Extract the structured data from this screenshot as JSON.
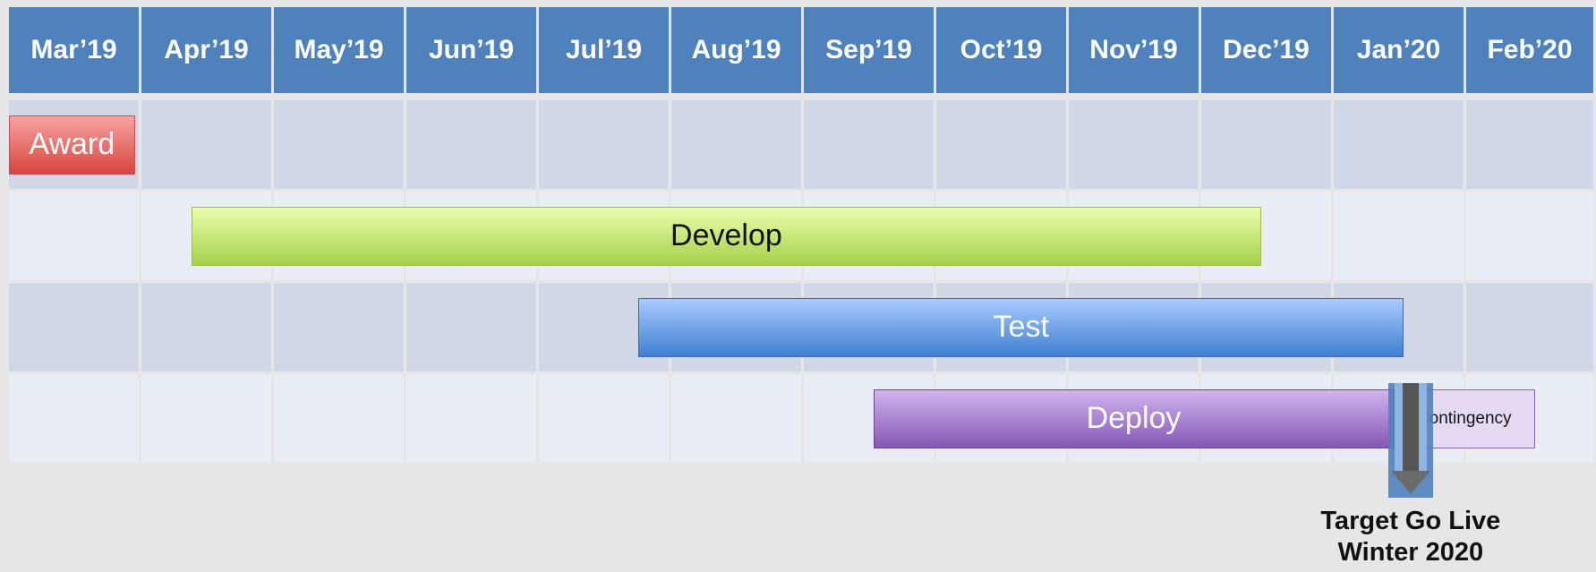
{
  "months": [
    "Mar’19",
    "Apr’19",
    "May’19",
    "Jun’19",
    "Jul’19",
    "Aug’19",
    "Sep’19",
    "Oct’19",
    "Nov’19",
    "Dec’19",
    "Jan’20",
    "Feb’20"
  ],
  "tasks": [
    {
      "name": "award-bar",
      "label": "Award",
      "start": 0.0,
      "end": 0.95,
      "row": 0,
      "style": "award"
    },
    {
      "name": "develop-bar",
      "label": "Develop",
      "start": 1.38,
      "end": 9.45,
      "row": 1,
      "style": "develop"
    },
    {
      "name": "test-bar",
      "label": "Test",
      "start": 4.75,
      "end": 10.53,
      "row": 2,
      "style": "test"
    },
    {
      "name": "deploy-bar",
      "label": "Deploy",
      "start": 6.53,
      "end": 10.45,
      "row": 3,
      "style": "deploy"
    },
    {
      "name": "contingency-bar",
      "label": "Contingency",
      "start": 10.45,
      "end": 11.53,
      "row": 3,
      "style": "contingency"
    }
  ],
  "milestone": {
    "position": 10.58,
    "line1": "Target Go Live",
    "line2": "Winter 2020"
  },
  "colors": {
    "header": "#4f81bd",
    "row_dark": "#d0d8e8",
    "row_light": "#e9edf4"
  }
}
